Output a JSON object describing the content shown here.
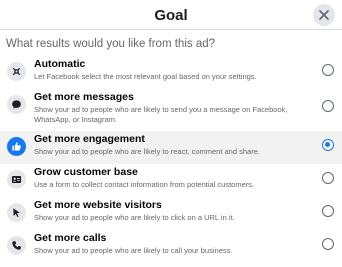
{
  "dialog": {
    "title": "Goal",
    "question": "What results would you like from this ad?"
  },
  "colors": {
    "accent": "#1877f2",
    "selected_row": "#f2f2f2",
    "icon_bg": "#e4e6eb"
  },
  "options": [
    {
      "icon": "automatic-icon",
      "name": "Automatic",
      "description": "Let Facebook select the most relevant goal based on your settings.",
      "selected": false
    },
    {
      "icon": "message-bubble-icon",
      "name": "Get more messages",
      "description": "Show your ad to people who are likely to send you a message on Facebook, WhatsApp, or Instagram.",
      "selected": false
    },
    {
      "icon": "thumbs-up-icon",
      "name": "Get more engagement",
      "description": "Show your ad to people who are likely to react, comment and share.",
      "selected": true
    },
    {
      "icon": "contact-card-icon",
      "name": "Grow customer base",
      "description": "Use a form to collect contact information from potential customers.",
      "selected": false
    },
    {
      "icon": "cursor-icon",
      "name": "Get more website visitors",
      "description": "Show your ad to people who are likely to click on a URL in it.",
      "selected": false
    },
    {
      "icon": "phone-icon",
      "name": "Get more calls",
      "description": "Show your ad to people who are likely to call your business.",
      "selected": false
    }
  ]
}
